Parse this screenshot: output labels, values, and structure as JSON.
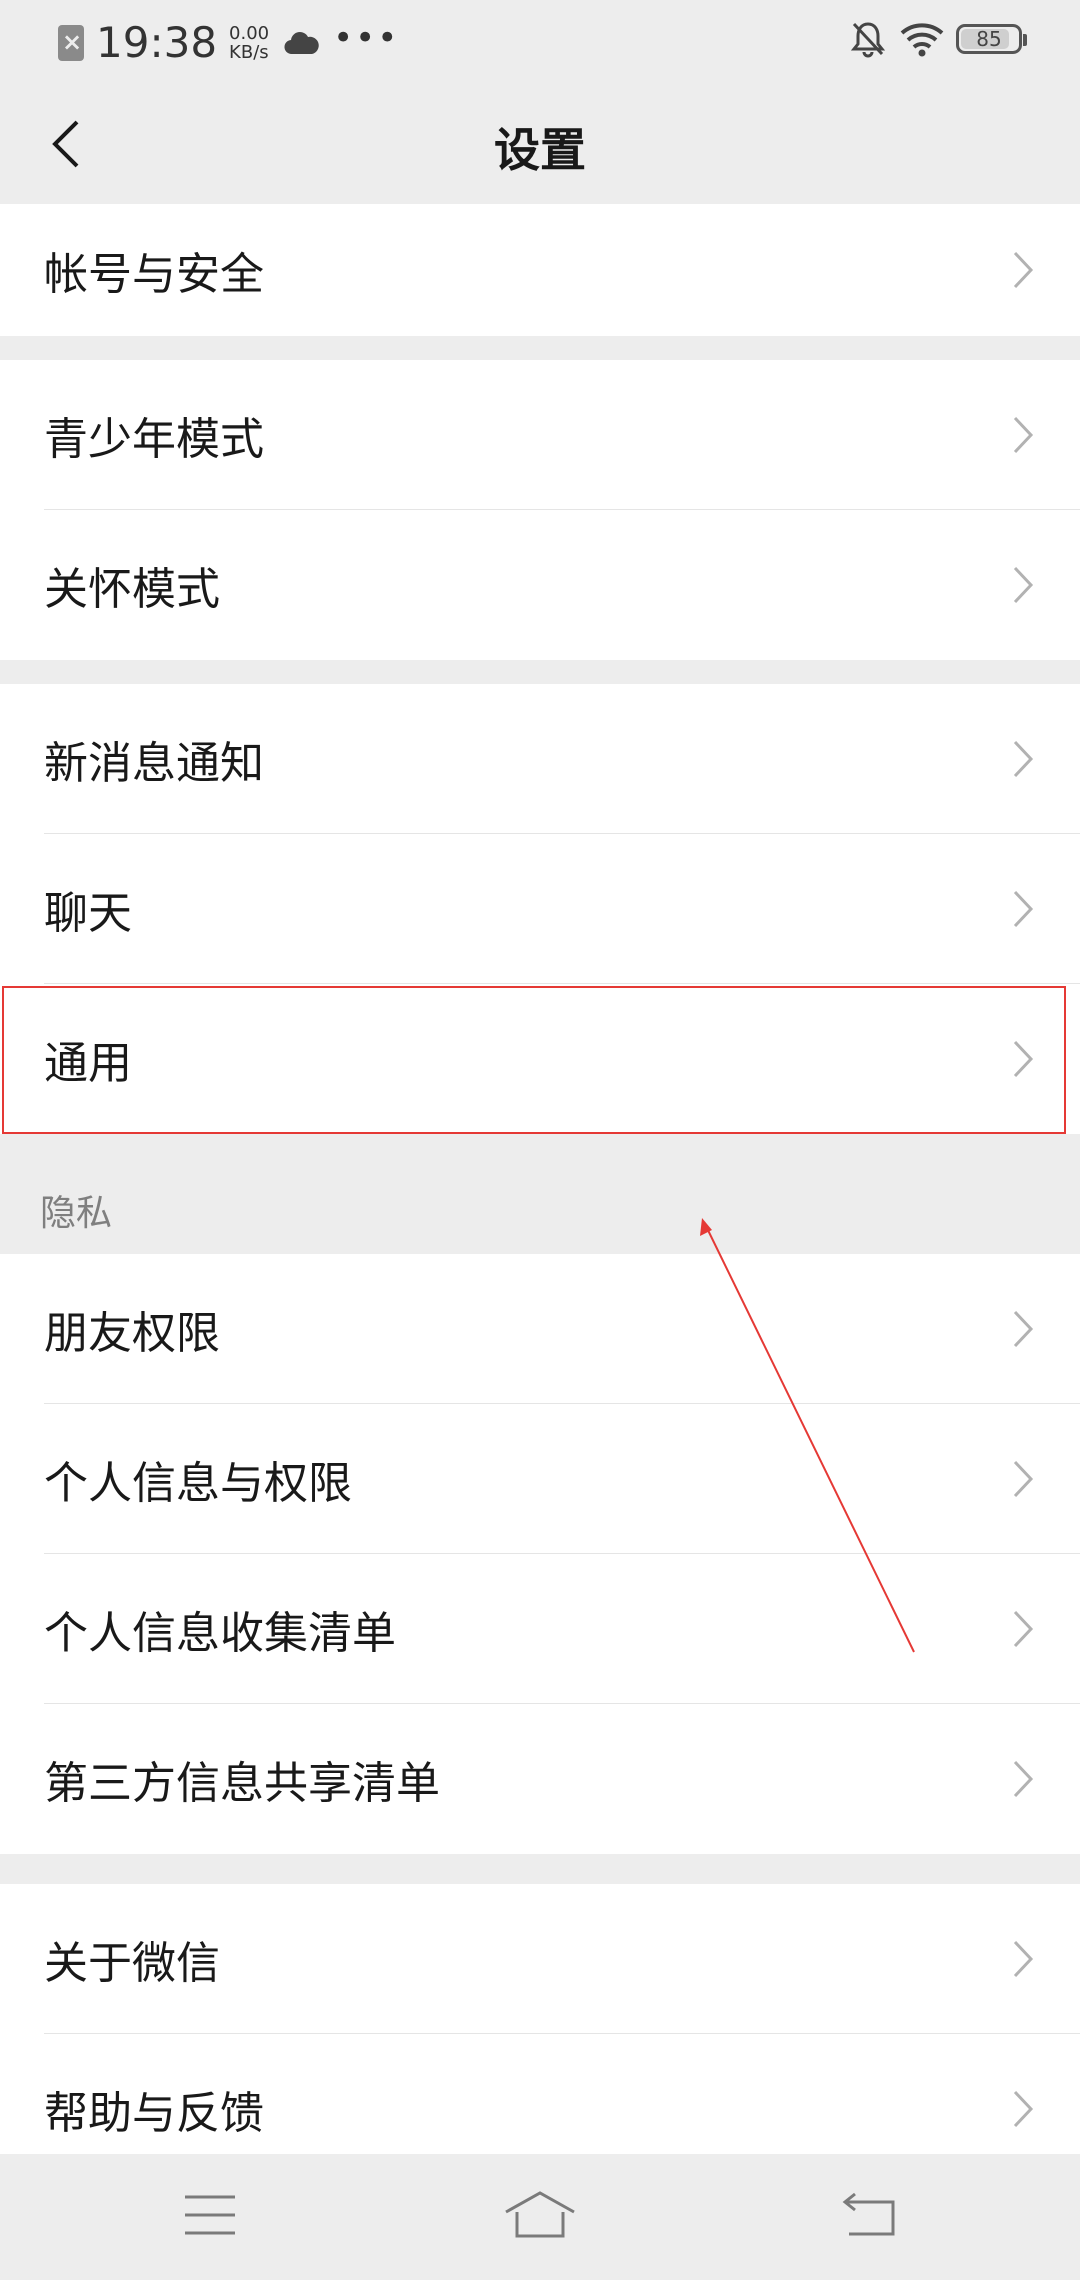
{
  "status_bar": {
    "time": "19:38",
    "net_speed_value": "0.00",
    "net_speed_unit": "KB/s",
    "dots": "•••",
    "battery": "85",
    "battery_level": 0.85
  },
  "header": {
    "title": "设置"
  },
  "groups": [
    {
      "items": [
        "帐号与安全"
      ]
    },
    {
      "items": [
        "青少年模式",
        "关怀模式"
      ]
    },
    {
      "items": [
        "新消息通知",
        "聊天",
        "通用"
      ]
    },
    {
      "items": [
        "朋友权限",
        "个人信息与权限",
        "个人信息收集清单",
        "第三方信息共享清单"
      ]
    },
    {
      "items": [
        "关于微信",
        "帮助与反馈"
      ]
    }
  ],
  "privacy_section_header": "隐私",
  "highlighted_item": "通用",
  "colors": {
    "background": "#ededed",
    "cell": "#ffffff",
    "text": "#191919",
    "secondary_text": "#7f7f7f",
    "chevron": "#b2b2b2",
    "annotation": "#e53935"
  },
  "system_nav": {
    "icons": [
      "menu-icon",
      "home-icon",
      "back-icon"
    ]
  }
}
